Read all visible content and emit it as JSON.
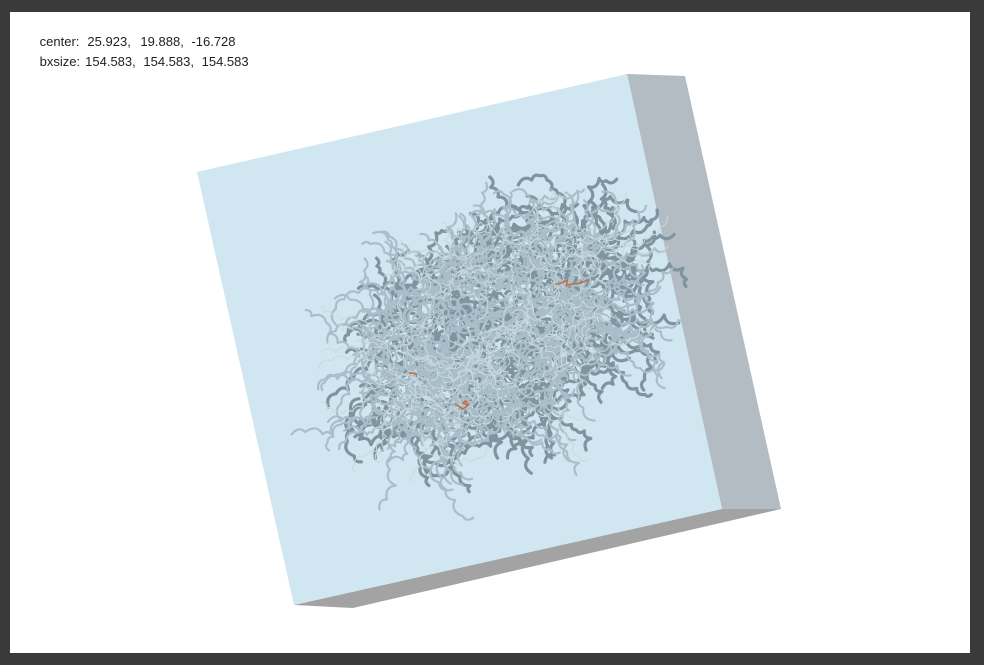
{
  "viewer": {
    "center": {
      "label": "center:",
      "x": "25.923",
      "y": "19.888",
      "z": "-16.728"
    },
    "bxsize": {
      "label": "bxsize:",
      "x": "154.583",
      "y": "154.583",
      "z": "154.583"
    }
  },
  "colors": {
    "box_front": "#d0e6f0",
    "box_side": "#b3bcc2",
    "box_bottom": "#a3a3a3",
    "protein_ribbon": "#a9bec8",
    "protein_shadow": "#7f949e",
    "ligand": "#c0704a",
    "frame": "#3a3a3a",
    "canvas": "#ffffff"
  }
}
